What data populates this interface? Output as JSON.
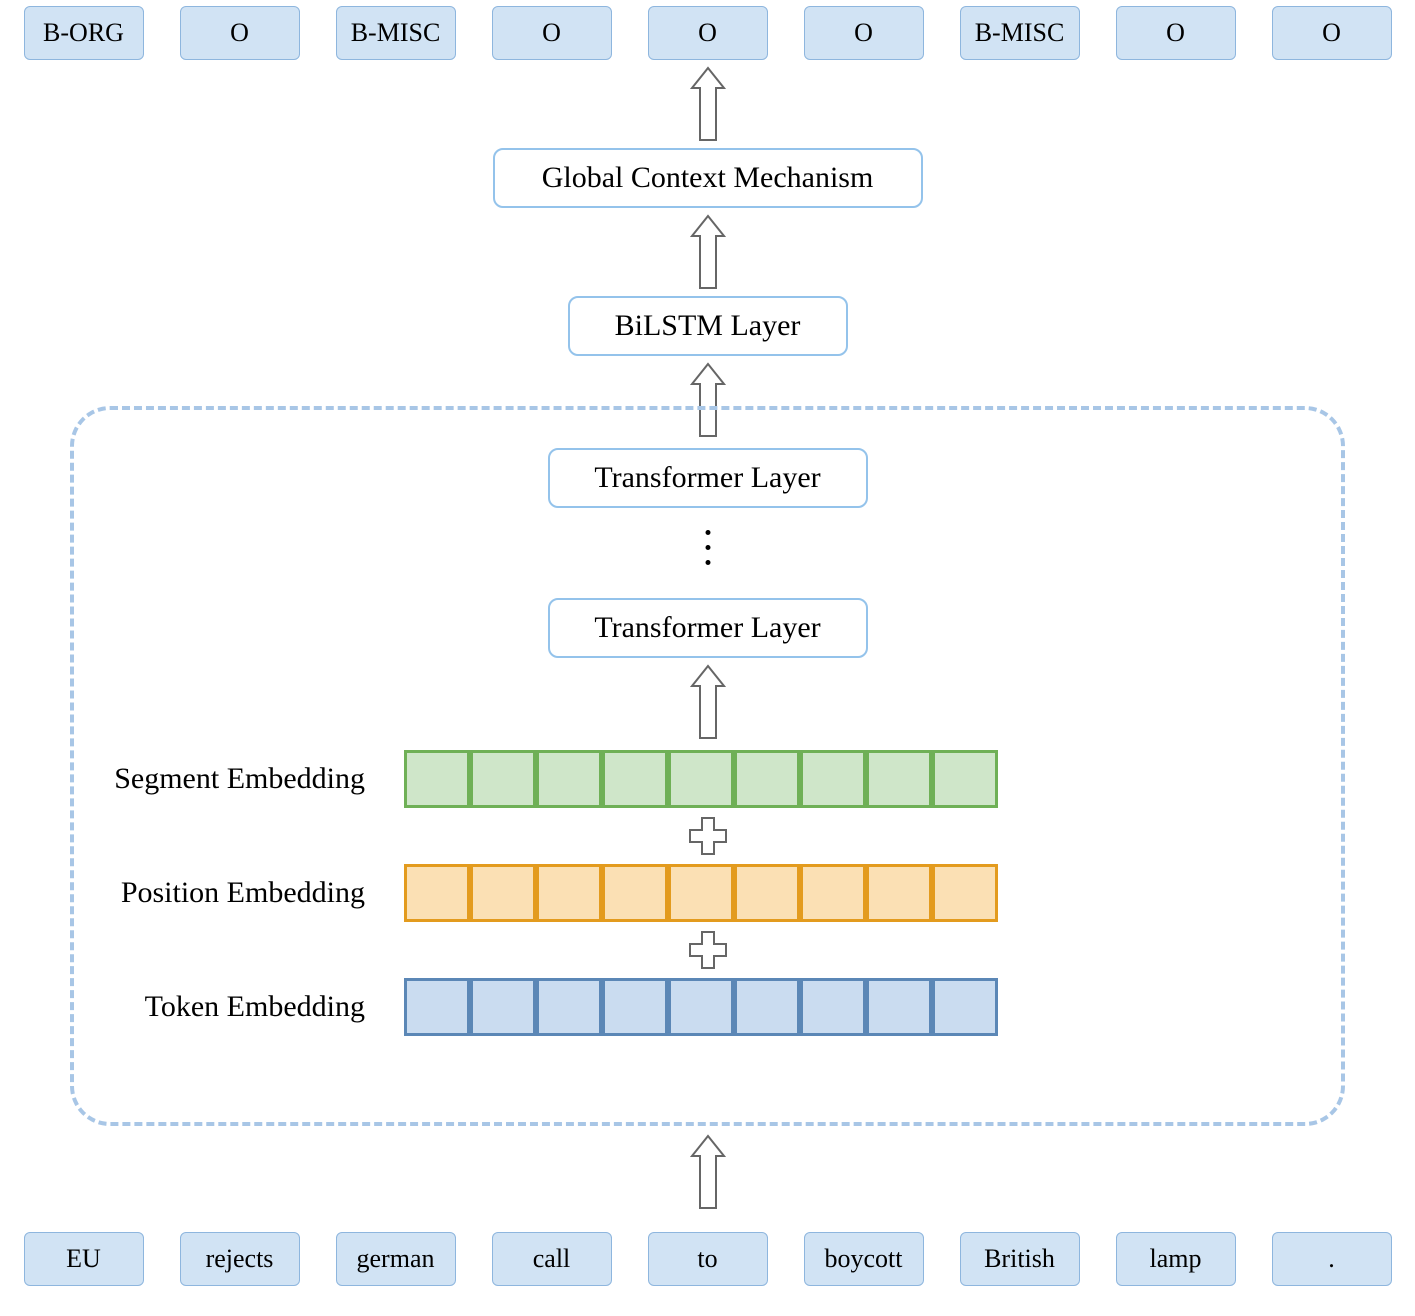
{
  "outputs": [
    "B-ORG",
    "O",
    "B-MISC",
    "O",
    "O",
    "O",
    "B-MISC",
    "O",
    "O"
  ],
  "inputs": [
    "EU",
    "rejects",
    "german",
    "call",
    "to",
    "boycott",
    "British",
    "lamp",
    "."
  ],
  "layers": {
    "global_context": "Global Context Mechanism",
    "bilstm": "BiLSTM Layer",
    "transformer_top": "Transformer Layer",
    "transformer_bottom": "Transformer Layer"
  },
  "embeddings": {
    "segment": "Segment Embedding",
    "position": "Position Embedding",
    "token": "Token Embedding",
    "cells": 9
  }
}
